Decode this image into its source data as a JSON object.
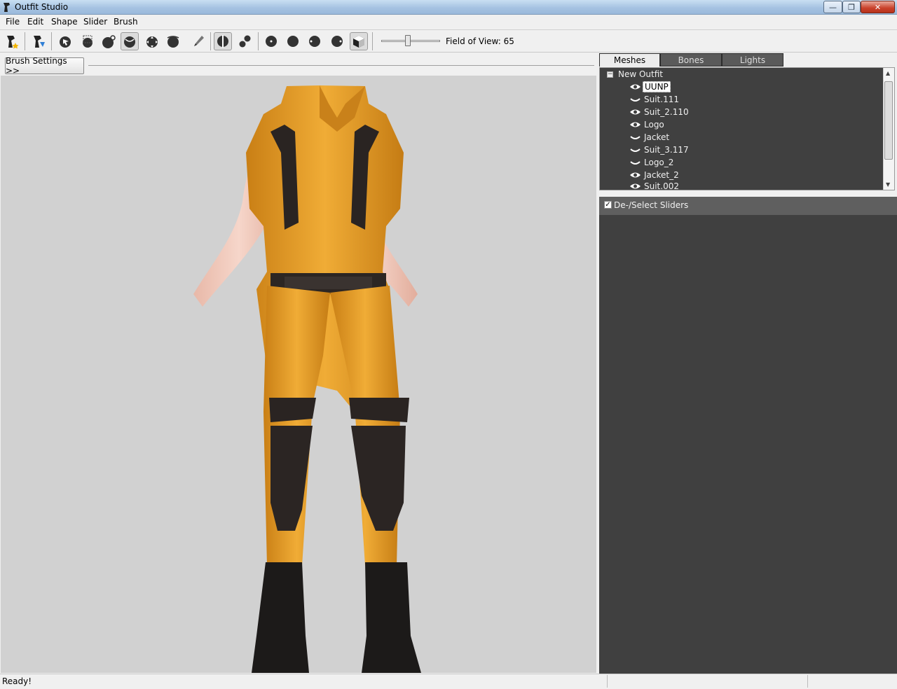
{
  "window": {
    "title": "Outfit Studio",
    "min_glyph": "—",
    "max_glyph": "❐",
    "close_glyph": "✕"
  },
  "menu": [
    "File",
    "Edit",
    "Shape",
    "Slider",
    "Brush"
  ],
  "toolbar": {
    "fov_label": "Field of View: 65",
    "fov_value": 65
  },
  "brush_settings_label": "Brush Settings >>",
  "panel_tabs": [
    {
      "label": "Meshes",
      "active": true
    },
    {
      "label": "Bones",
      "active": false
    },
    {
      "label": "Lights",
      "active": false
    }
  ],
  "tree": {
    "root_label": "New Outfit",
    "expander_glyph": "−",
    "items": [
      {
        "label": "UUNP",
        "visible": true,
        "selected": true
      },
      {
        "label": "Suit.111",
        "visible": false
      },
      {
        "label": "Suit_2.110",
        "visible": true
      },
      {
        "label": "Logo",
        "visible": true
      },
      {
        "label": "Jacket",
        "visible": false
      },
      {
        "label": "Suit_3.117",
        "visible": false
      },
      {
        "label": "Logo_2",
        "visible": false
      },
      {
        "label": "Jacket_2",
        "visible": true
      },
      {
        "label": "Suit.002",
        "visible": true
      }
    ]
  },
  "sliders": {
    "label": "De-/Select Sliders",
    "checked": true,
    "check_glyph": "✓"
  },
  "status": {
    "text": "Ready!"
  },
  "colors": {
    "suit": "#e9a02a",
    "suit_dark": "#2a2422",
    "skin": "#f0c7b8",
    "viewport_bg": "#d1d1d1",
    "panel_bg": "#404040"
  }
}
